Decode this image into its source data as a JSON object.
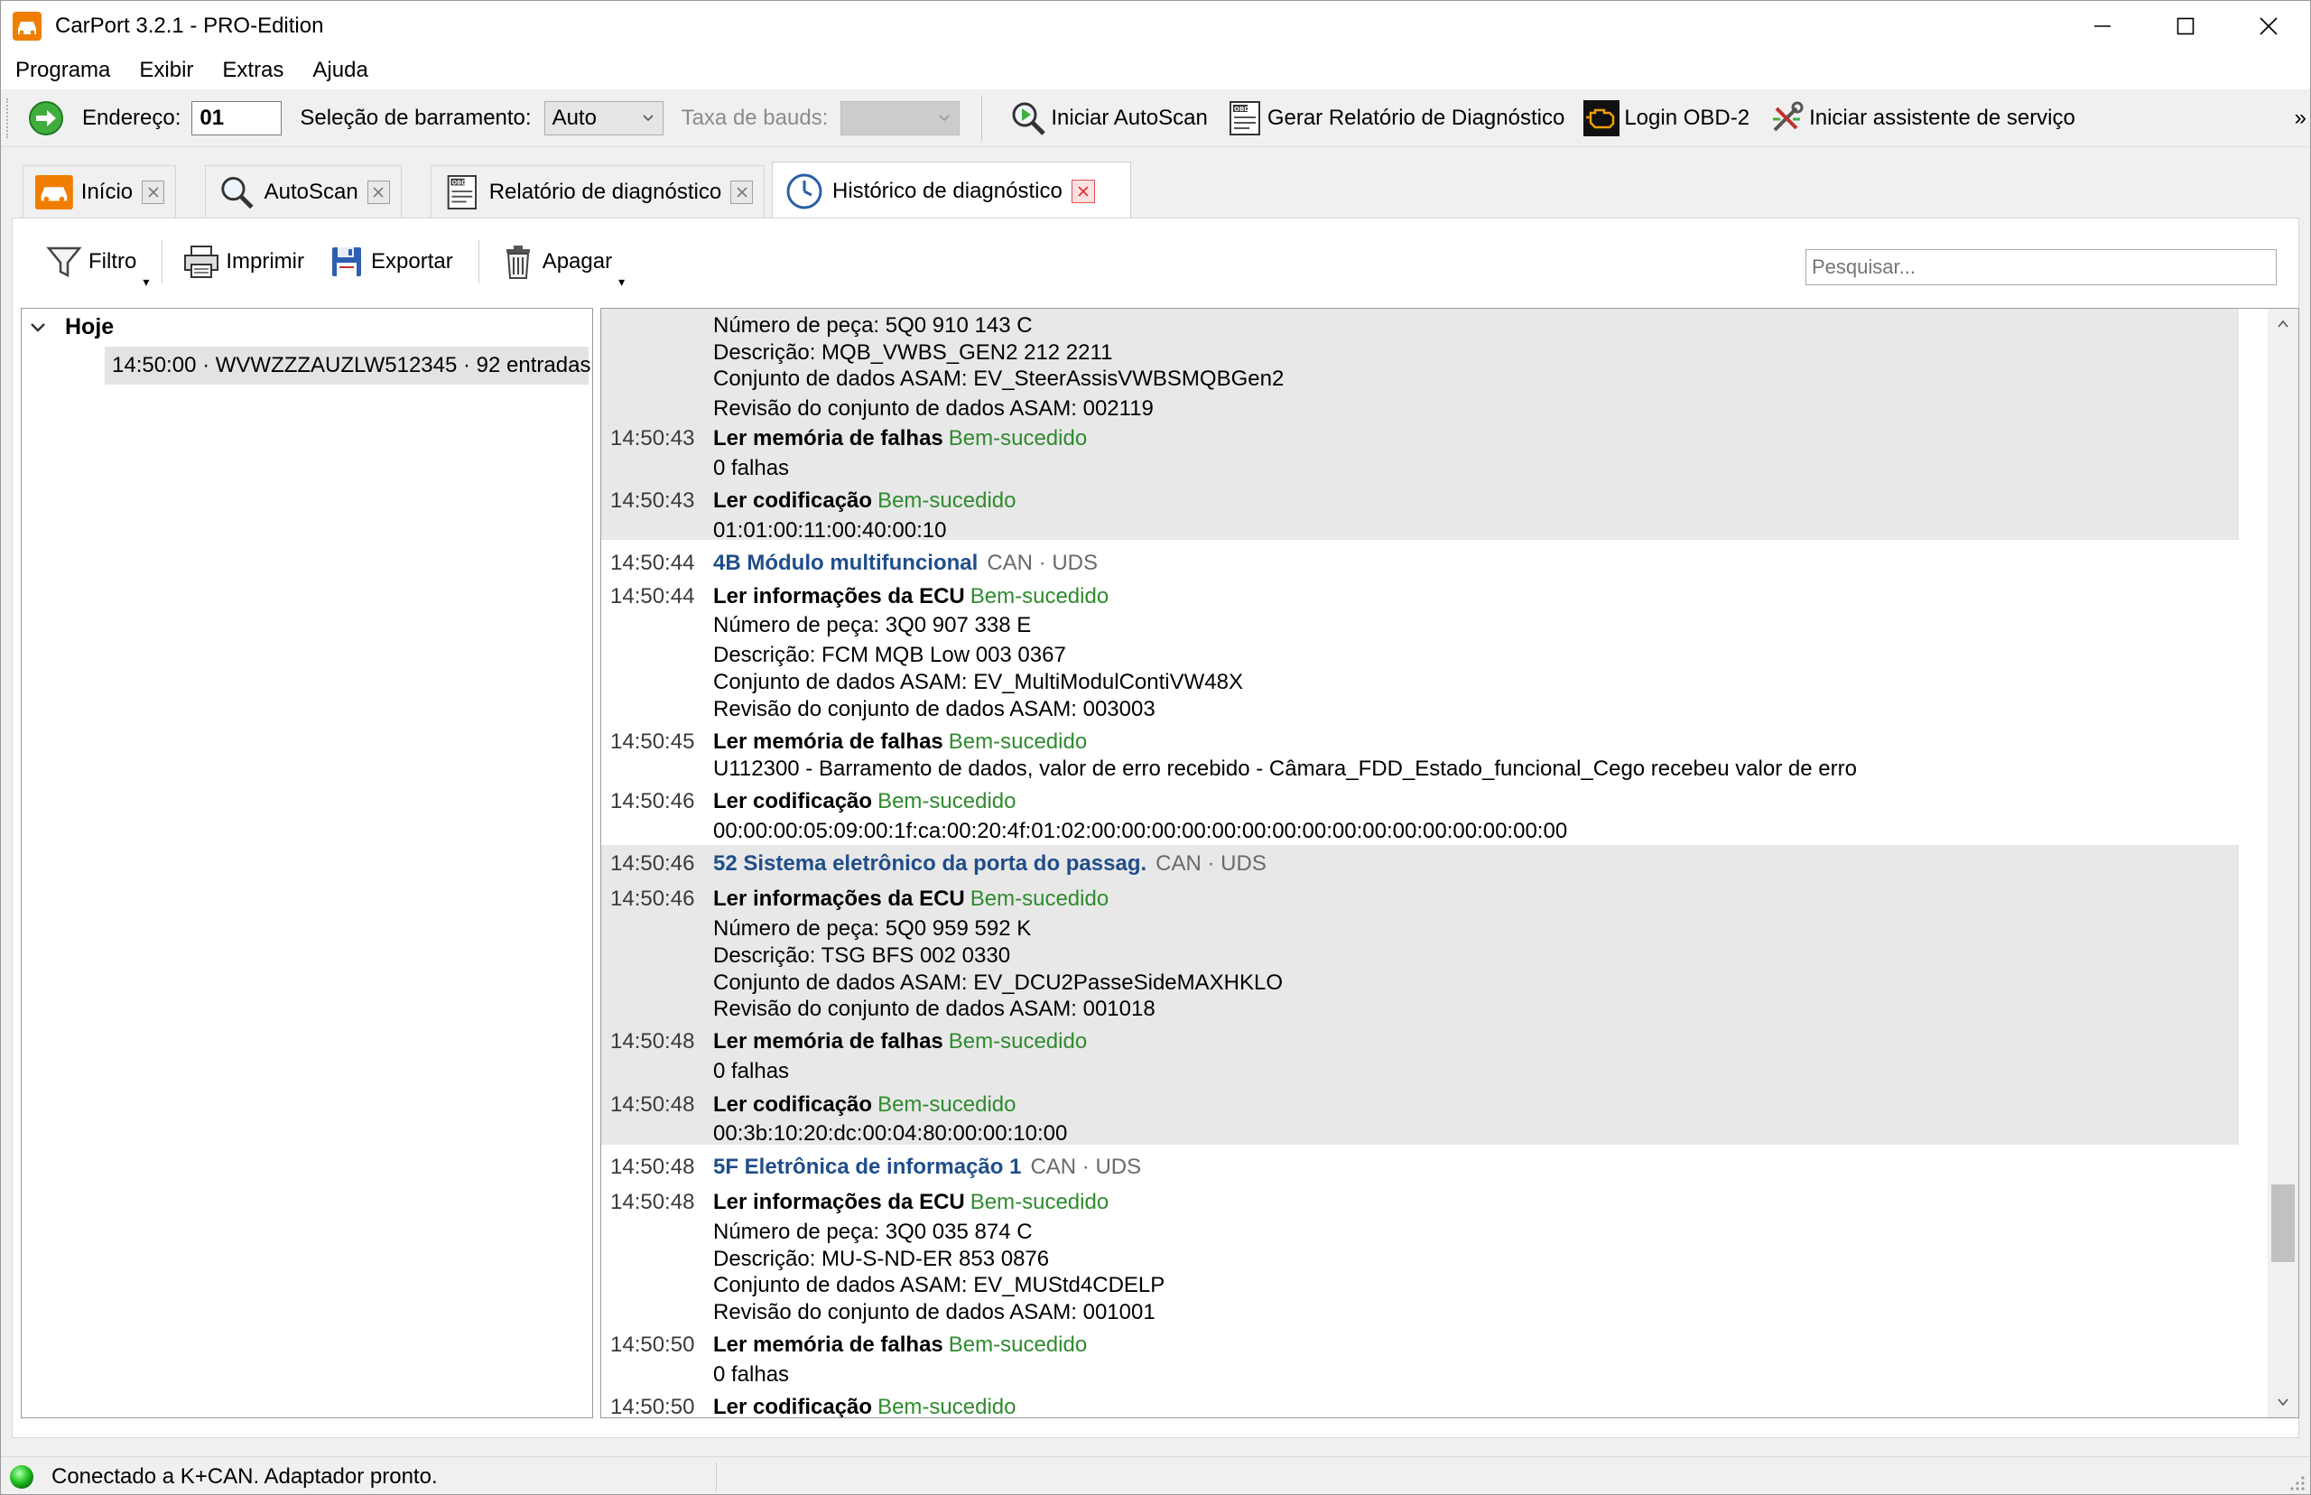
{
  "window": {
    "title": "CarPort 3.2.1 - PRO-Edition",
    "accent": "#f07d00"
  },
  "menu": [
    "Programa",
    "Exibir",
    "Extras",
    "Ajuda"
  ],
  "toolbar": {
    "address_label": "Endereço:",
    "address_value": "01",
    "bus_label": "Seleção de barramento:",
    "bus_value": "Auto",
    "baud_label": "Taxa de bauds:",
    "baud_value": "",
    "actions": [
      {
        "label": "Iniciar AutoScan",
        "icon": "autoscan-icon"
      },
      {
        "label": "Gerar Relatório de Diagnóstico",
        "icon": "obd-report-icon"
      },
      {
        "label": "Login OBD-2",
        "icon": "engine-icon"
      },
      {
        "label": "Iniciar assistente de serviço",
        "icon": "service-tools-icon"
      }
    ],
    "more": "»"
  },
  "tabs": [
    {
      "label": "Início",
      "icon": "car-icon",
      "active": false
    },
    {
      "label": "AutoScan",
      "icon": "magnifier-icon",
      "active": false
    },
    {
      "label": "Relatório de diagnóstico",
      "icon": "obd-report-icon",
      "active": false
    },
    {
      "label": "Histórico de diagnóstico",
      "icon": "clock-icon",
      "active": true
    }
  ],
  "subtoolbar": {
    "filter": "Filtro",
    "print": "Imprimir",
    "export": "Exportar",
    "delete": "Apagar",
    "search_placeholder": "Pesquisar..."
  },
  "tree": {
    "group": "Hoje",
    "item": "14:50:00 · WVWZZZAUZLW512345 · 92 entradas"
  },
  "log": {
    "colors": {
      "success": "#2e8b2e",
      "module": "#1f4e8a",
      "shade": "#e8e8e8"
    },
    "lines": [
      {
        "time": "",
        "text": "Número de peça: 5Q0 910 143 C"
      },
      {
        "time": "",
        "text": "Descrição: MQB_VWBS_GEN2 212 2211"
      },
      {
        "time": "",
        "text": "Conjunto de dados ASAM: EV_SteerAssisVWBSMQBGen2"
      },
      {
        "time": "",
        "text": "Revisão do conjunto de dados ASAM: 002119"
      },
      {
        "time": "14:50:43",
        "bold": "Ler memória de falhas",
        "status": "Bem-sucedido"
      },
      {
        "time": "",
        "text": "0 falhas"
      },
      {
        "time": "14:50:43",
        "bold": "Ler codificação",
        "status": "Bem-sucedido"
      },
      {
        "time": "",
        "text": "01:01:00:11:00:40:00:10"
      },
      {
        "time": "14:50:44",
        "module": "4B Módulo multifuncional",
        "proto": "CAN · UDS"
      },
      {
        "time": "14:50:44",
        "bold": "Ler informações da ECU",
        "status": "Bem-sucedido"
      },
      {
        "time": "",
        "text": "Número de peça: 3Q0 907 338 E"
      },
      {
        "time": "",
        "text": "Descrição: FCM MQB Low 003 0367"
      },
      {
        "time": "",
        "text": "Conjunto de dados ASAM: EV_MultiModulContiVW48X"
      },
      {
        "time": "",
        "text": "Revisão do conjunto de dados ASAM: 003003"
      },
      {
        "time": "14:50:45",
        "bold": "Ler memória de falhas",
        "status": "Bem-sucedido"
      },
      {
        "time": "",
        "text": "U112300 - Barramento de dados, valor de erro recebido - Câmara_FDD_Estado_funcional_Cego recebeu valor de erro"
      },
      {
        "time": "14:50:46",
        "bold": "Ler codificação",
        "status": "Bem-sucedido"
      },
      {
        "time": "",
        "text": "00:00:00:05:09:00:1f:ca:00:20:4f:01:02:00:00:00:00:00:00:00:00:00:00:00:00:00:00:00:00"
      },
      {
        "time": "14:50:46",
        "module": "52 Sistema eletrônico da porta do passag.",
        "proto": "CAN · UDS"
      },
      {
        "time": "14:50:46",
        "bold": "Ler informações da ECU",
        "status": "Bem-sucedido"
      },
      {
        "time": "",
        "text": "Número de peça: 5Q0 959 592 K"
      },
      {
        "time": "",
        "text": "Descrição: TSG BFS 002 0330"
      },
      {
        "time": "",
        "text": "Conjunto de dados ASAM: EV_DCU2PasseSideMAXHKLO"
      },
      {
        "time": "",
        "text": "Revisão do conjunto de dados ASAM: 001018"
      },
      {
        "time": "14:50:48",
        "bold": "Ler memória de falhas",
        "status": "Bem-sucedido"
      },
      {
        "time": "",
        "text": "0 falhas"
      },
      {
        "time": "14:50:48",
        "bold": "Ler codificação",
        "status": "Bem-sucedido"
      },
      {
        "time": "",
        "text": "00:3b:10:20:dc:00:04:80:00:00:10:00"
      },
      {
        "time": "14:50:48",
        "module": "5F Eletrônica de informação 1",
        "proto": "CAN · UDS"
      },
      {
        "time": "14:50:48",
        "bold": "Ler informações da ECU",
        "status": "Bem-sucedido"
      },
      {
        "time": "",
        "text": "Número de peça: 3Q0 035 874 C"
      },
      {
        "time": "",
        "text": "Descrição: MU-S-ND-ER 853 0876"
      },
      {
        "time": "",
        "text": "Conjunto de dados ASAM: EV_MUStd4CDELP"
      },
      {
        "time": "",
        "text": "Revisão do conjunto de dados ASAM: 001001"
      },
      {
        "time": "14:50:50",
        "bold": "Ler memória de falhas",
        "status": "Bem-sucedido"
      },
      {
        "time": "",
        "text": "0 falhas"
      },
      {
        "time": "14:50:50",
        "bold": "Ler codificação",
        "status": "Bem-sucedido"
      }
    ]
  },
  "status": {
    "text": "Conectado a K+CAN. Adaptador pronto.",
    "led_color": "#22c322"
  }
}
